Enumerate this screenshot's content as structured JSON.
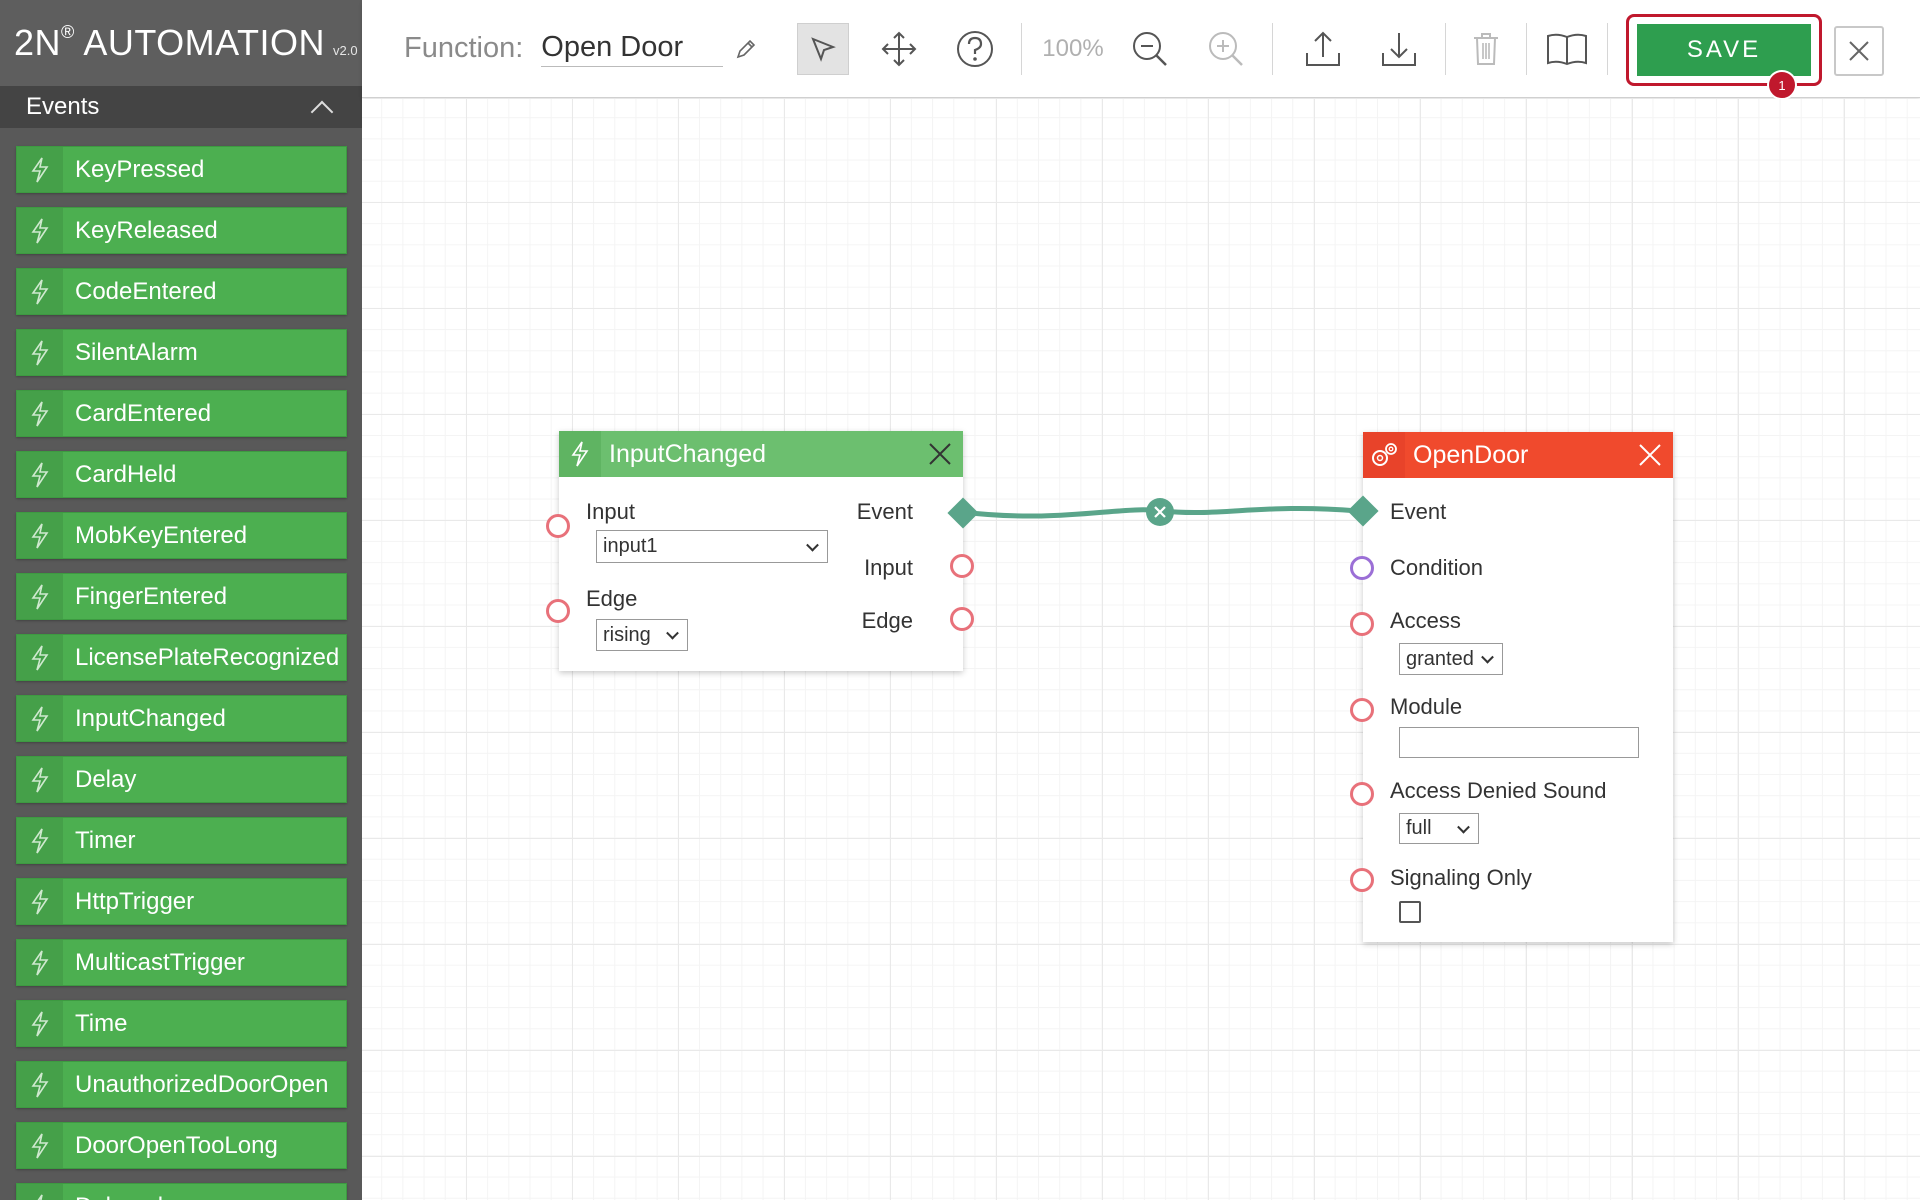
{
  "brand": {
    "name": "2N",
    "reg": "®",
    "product": " AUTOMATION",
    "version": "v2.0"
  },
  "sidebar": {
    "section_title": "Events",
    "items": [
      {
        "label": "KeyPressed"
      },
      {
        "label": "KeyReleased"
      },
      {
        "label": "CodeEntered"
      },
      {
        "label": "SilentAlarm"
      },
      {
        "label": "CardEntered"
      },
      {
        "label": "CardHeld"
      },
      {
        "label": "MobKeyEntered"
      },
      {
        "label": "FingerEntered"
      },
      {
        "label": "LicensePlateRecognized"
      },
      {
        "label": "InputChanged"
      },
      {
        "label": "Delay"
      },
      {
        "label": "Timer"
      },
      {
        "label": "HttpTrigger"
      },
      {
        "label": "MulticastTrigger"
      },
      {
        "label": "Time"
      },
      {
        "label": "UnauthorizedDoorOpen"
      },
      {
        "label": "DoorOpenTooLong"
      },
      {
        "label": "Delayed..."
      }
    ]
  },
  "toolbar": {
    "function_label": "Function:",
    "function_name": "Open Door",
    "zoom": "100%",
    "save_label": "SAVE",
    "badge_count": "1"
  },
  "nodes": {
    "input_changed": {
      "title": "InputChanged",
      "input_label": "Input",
      "input_value": "input1",
      "edge_label": "Edge",
      "edge_value": "rising",
      "out_event": "Event",
      "out_input": "Input",
      "out_edge": "Edge"
    },
    "open_door": {
      "title": "OpenDoor",
      "event_label": "Event",
      "condition_label": "Condition",
      "access_label": "Access",
      "access_value": "granted",
      "module_label": "Module",
      "module_value": "",
      "denied_sound_label": "Access Denied Sound",
      "denied_sound_value": "full",
      "signaling_label": "Signaling Only",
      "signaling_checked": false
    }
  },
  "colors": {
    "event_green": "#4caf50",
    "node_green": "#6cbf6f",
    "action_red": "#f04a2d",
    "save_green": "#2e9e4f",
    "highlight_red": "#c0182d",
    "connector": "#5aa58a"
  }
}
